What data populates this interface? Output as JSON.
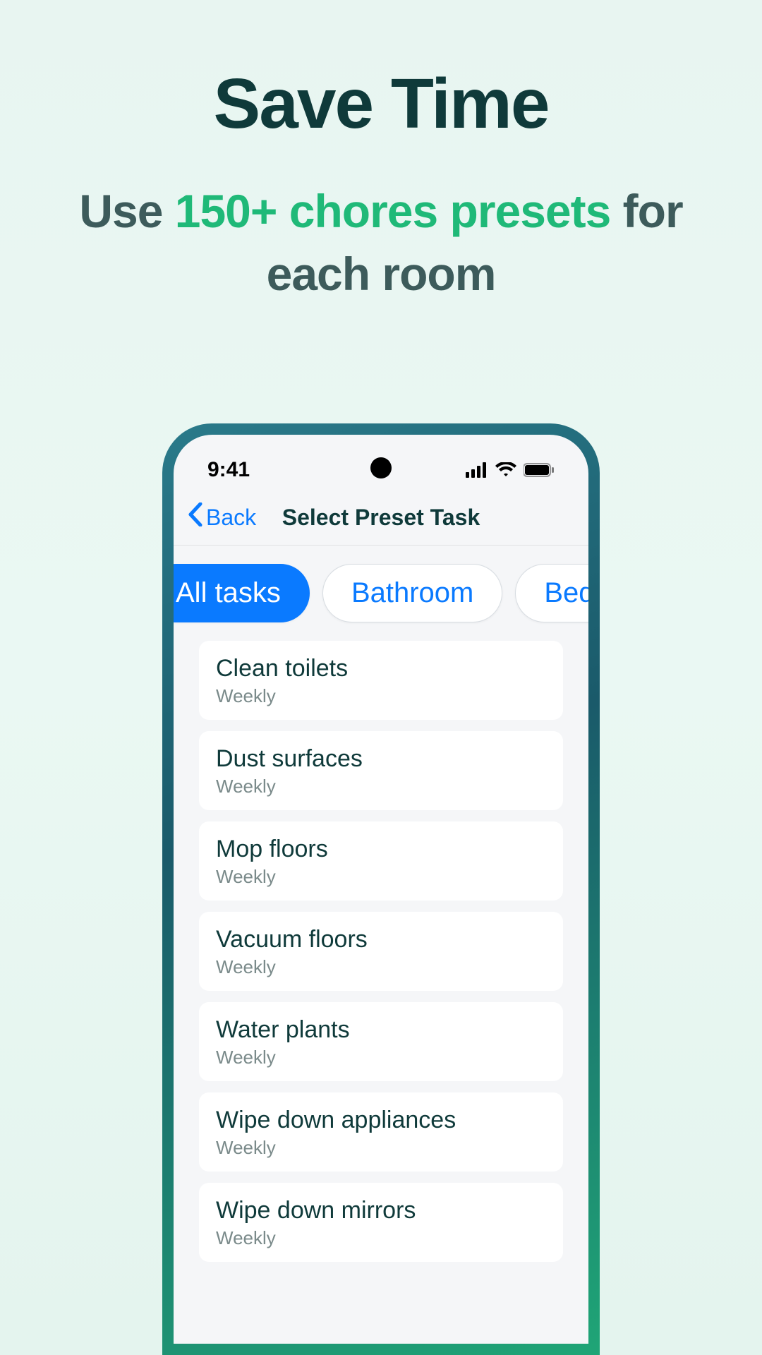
{
  "marketing": {
    "headline": "Save Time",
    "sub_pre": "Use ",
    "sub_accent": "150+ chores presets",
    "sub_post": " for each room"
  },
  "statusbar": {
    "time": "9:41"
  },
  "nav": {
    "back": "Back",
    "title": "Select Preset Task"
  },
  "chips": [
    {
      "label": "All tasks",
      "active": true
    },
    {
      "label": "Bathroom",
      "active": false
    },
    {
      "label": "Bedroom",
      "active": false
    }
  ],
  "tasks": [
    {
      "title": "Clean toilets",
      "freq": "Weekly"
    },
    {
      "title": "Dust surfaces",
      "freq": "Weekly"
    },
    {
      "title": "Mop floors",
      "freq": "Weekly"
    },
    {
      "title": "Vacuum floors",
      "freq": "Weekly"
    },
    {
      "title": "Water plants",
      "freq": "Weekly"
    },
    {
      "title": "Wipe down appliances",
      "freq": "Weekly"
    },
    {
      "title": "Wipe down mirrors",
      "freq": "Weekly"
    }
  ]
}
